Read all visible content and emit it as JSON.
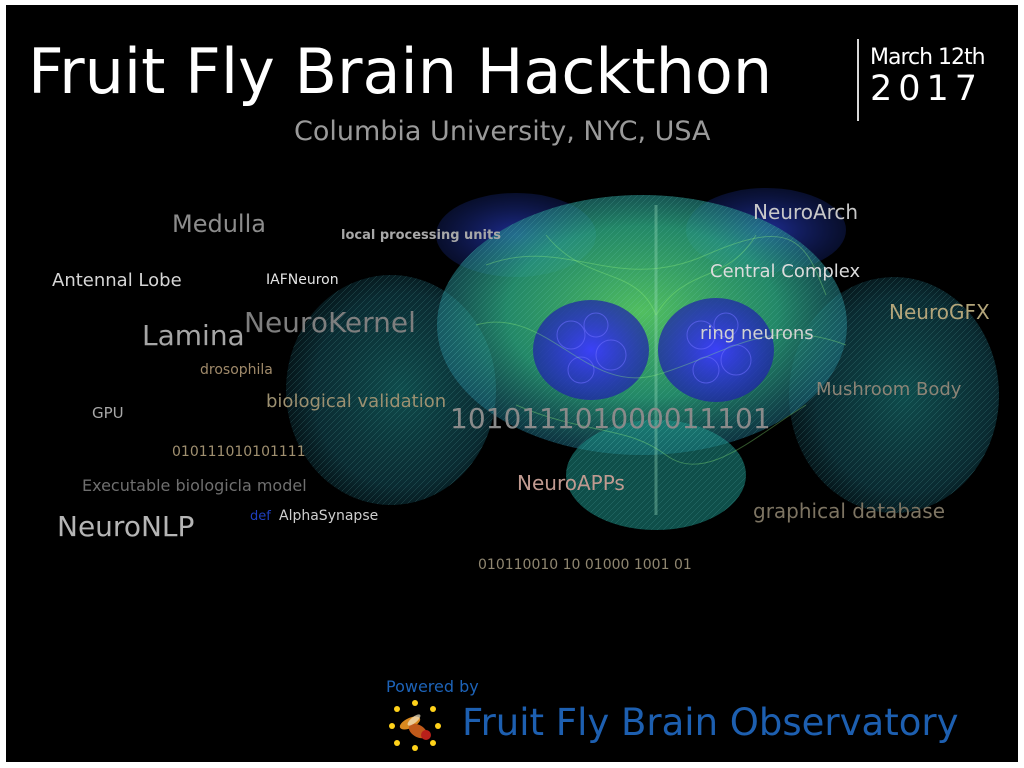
{
  "poster": {
    "title": "Fruit Fly Brain Hackthon",
    "date": "March 12th",
    "year": "2017",
    "subtitle": "Columbia University, NYC, USA"
  },
  "word_cloud": [
    {
      "name": "word-medulla",
      "text": "Medulla",
      "color": "#8c8c8c"
    },
    {
      "name": "word-local-processing-units",
      "text": "local processing units",
      "color": "#a8a8a8"
    },
    {
      "name": "word-neuroarch",
      "text": "NeuroArch",
      "color": "#c8c8c8"
    },
    {
      "name": "word-antennal-lobe",
      "text": "Antennal Lobe",
      "color": "#d6d6d6"
    },
    {
      "name": "word-iafneuron",
      "text": "IAFNeuron",
      "color": "#e6e6e6"
    },
    {
      "name": "word-central-complex",
      "text": "Central Complex",
      "color": "#dcdcdc"
    },
    {
      "name": "word-lamina",
      "text": "Lamina",
      "color": "#a6a6a6"
    },
    {
      "name": "word-neurokernel",
      "text": "NeuroKernel",
      "color": "#7e7e7e"
    },
    {
      "name": "word-neurogfx",
      "text": "NeuroGFX",
      "color": "#b3a57a"
    },
    {
      "name": "word-ring-neurons",
      "text": "ring neurons",
      "color": "#d2d2d2"
    },
    {
      "name": "word-drosophila",
      "text": "drosophila",
      "color": "#a08a6a"
    },
    {
      "name": "word-mushroom-body",
      "text": "Mushroom Body",
      "color": "#8c8476"
    },
    {
      "name": "word-biological-validation",
      "text": "biological validation",
      "color": "#9c9070"
    },
    {
      "name": "word-gpu",
      "text": "GPU",
      "color": "#a8a8a8"
    },
    {
      "name": "word-binary-large",
      "text": "101011101000011101",
      "color": "#8a8a8a"
    },
    {
      "name": "word-binary-small",
      "text": "010111010101111",
      "color": "#a09070"
    },
    {
      "name": "word-neuroapps",
      "text": "NeuroAPPs",
      "color": "#c09a90"
    },
    {
      "name": "word-executable-model",
      "text": "Executable biologicla model",
      "color": "#6f6f6f"
    },
    {
      "name": "word-graphical-database",
      "text": "graphical database",
      "color": "#7d7462"
    },
    {
      "name": "word-neuronlp",
      "text": "NeuroNLP",
      "color": "#b5b5b5"
    },
    {
      "name": "word-def",
      "text": "def",
      "color": "#1f3fbf"
    },
    {
      "name": "word-alphasynapse",
      "text": "AlphaSynapse",
      "color": "#cfcfcf"
    },
    {
      "name": "word-binary-spaced",
      "text": "010110010 10 01000 1001 01",
      "color": "#8f8670"
    }
  ],
  "footer": {
    "powered_by": "Powered by",
    "observatory_name": "Fruit Fly Brain Observatory",
    "brand_color": "#1d5fb0"
  },
  "icons": [
    "brain-render-image",
    "fly-logo-icon"
  ]
}
